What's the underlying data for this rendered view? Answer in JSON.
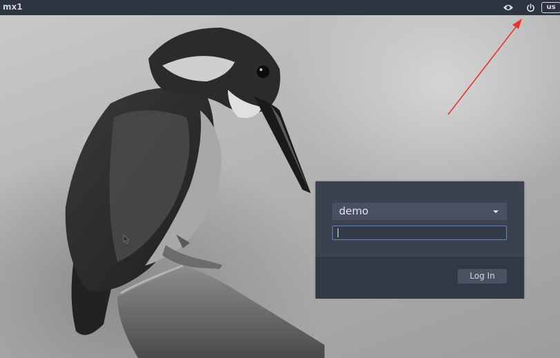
{
  "panel": {
    "hostname": "mx1",
    "icons": [
      "eye-icon",
      "power-icon"
    ],
    "keyboard_layout": "us",
    "background_color": "#2e3340"
  },
  "login": {
    "selected_user": "demo",
    "password_value": "",
    "login_label": "Log In"
  },
  "colors": {
    "annotation_arrow": "#e8342c",
    "field_focus_border": "#5b88c4"
  }
}
